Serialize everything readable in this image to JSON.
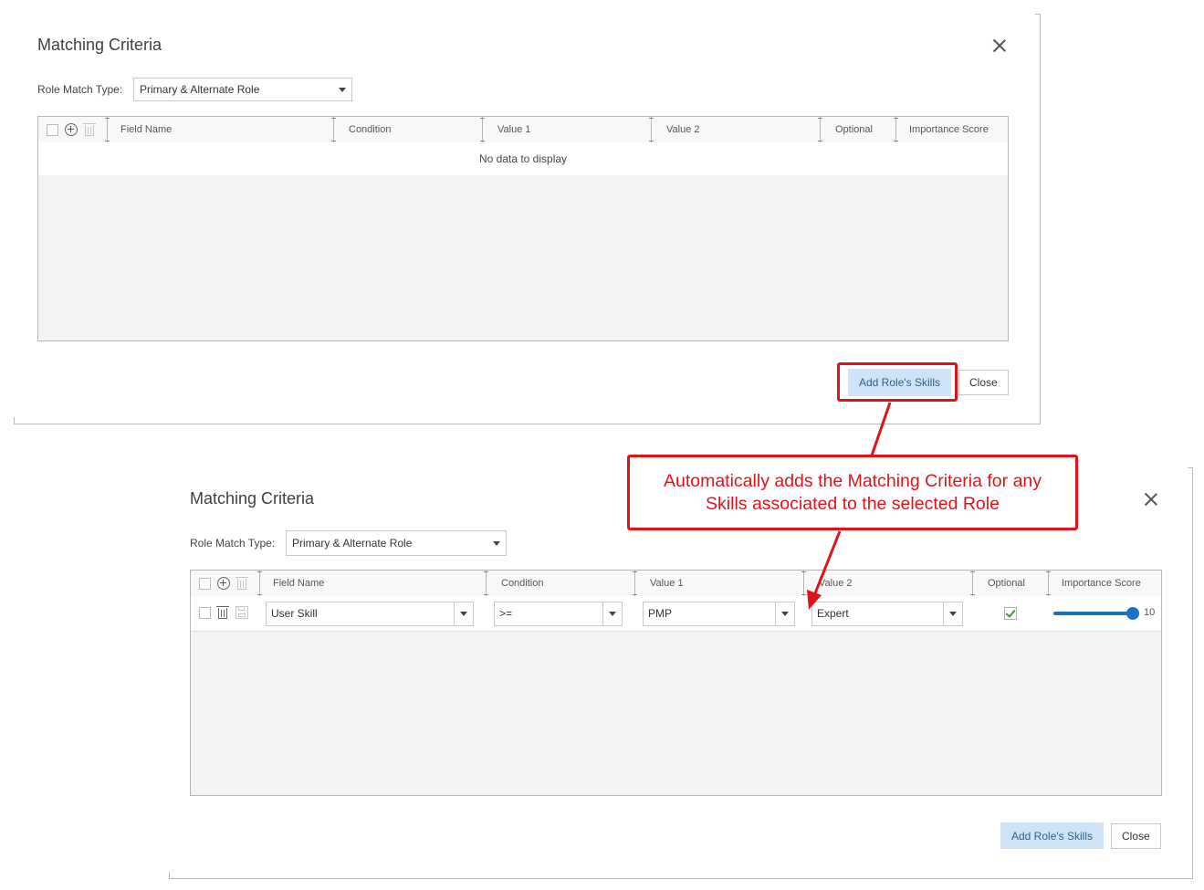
{
  "dialog1": {
    "title": "Matching Criteria",
    "role_match_type_label": "Role Match Type:",
    "role_match_type_value": "Primary & Alternate Role",
    "columns": [
      "Field Name",
      "Condition",
      "Value 1",
      "Value 2",
      "Optional",
      "Importance Score"
    ],
    "empty_message": "No data to display",
    "add_skills_label": "Add Role's Skills",
    "close_label": "Close"
  },
  "dialog2": {
    "title": "Matching Criteria",
    "role_match_type_label": "Role Match Type:",
    "role_match_type_value": "Primary & Alternate Role",
    "columns": [
      "Field Name",
      "Condition",
      "Value 1",
      "Value 2",
      "Optional",
      "Importance Score"
    ],
    "rows": [
      {
        "field_name": "User Skill",
        "condition": ">=",
        "value1": "PMP",
        "value2": "Expert",
        "optional": true,
        "importance_score": "10"
      }
    ],
    "add_skills_label": "Add Role's Skills",
    "close_label": "Close"
  },
  "annotation": {
    "line1": "Automatically adds the Matching Criteria for any",
    "line2": "Skills associated to the selected Role",
    "color": "#e1131a"
  },
  "colors": {
    "accent_button_bg": "#cfe3f6",
    "slider": "#1a73c8",
    "check": "#3c9a2e"
  }
}
